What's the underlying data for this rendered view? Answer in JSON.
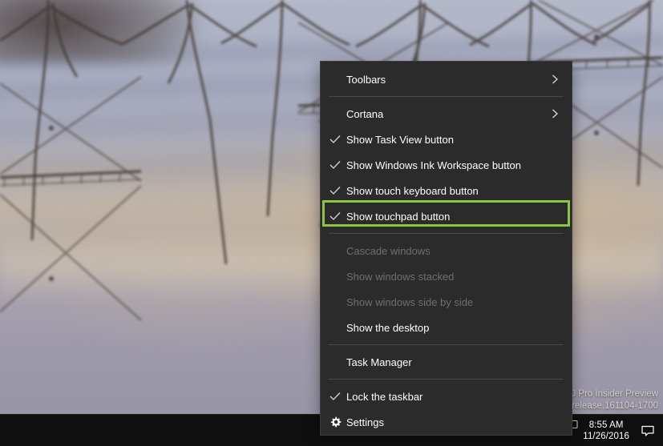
{
  "desktop": {
    "wallpaper_description": "blurred photo of a pier structure over calm water",
    "wallpaper_colors": {
      "top": "#b9bdcb",
      "mid_warm": "#c8b291",
      "bottom": "#9a97a8"
    }
  },
  "context_menu": {
    "name": "taskbar-context-menu",
    "background": "#2b2b2b",
    "items": [
      {
        "id": "toolbars",
        "label": "Toolbars",
        "type": "submenu",
        "checked": false,
        "disabled": false,
        "separator_after": true
      },
      {
        "id": "cortana",
        "label": "Cortana",
        "type": "submenu",
        "checked": false,
        "disabled": false,
        "separator_after": false
      },
      {
        "id": "task-view",
        "label": "Show Task View button",
        "type": "checkbox",
        "checked": true,
        "disabled": false,
        "separator_after": false
      },
      {
        "id": "windows-ink",
        "label": "Show Windows Ink Workspace button",
        "type": "checkbox",
        "checked": true,
        "disabled": false,
        "separator_after": false
      },
      {
        "id": "touch-keyboard",
        "label": "Show touch keyboard button",
        "type": "checkbox",
        "checked": true,
        "disabled": false,
        "separator_after": false
      },
      {
        "id": "touchpad",
        "label": "Show touchpad button",
        "type": "checkbox",
        "checked": true,
        "disabled": false,
        "separator_after": true,
        "highlighted": true
      },
      {
        "id": "cascade",
        "label": "Cascade windows",
        "type": "command",
        "checked": false,
        "disabled": true,
        "separator_after": false
      },
      {
        "id": "stacked",
        "label": "Show windows stacked",
        "type": "command",
        "checked": false,
        "disabled": true,
        "separator_after": false
      },
      {
        "id": "side-by-side",
        "label": "Show windows side by side",
        "type": "command",
        "checked": false,
        "disabled": true,
        "separator_after": false
      },
      {
        "id": "show-desktop",
        "label": "Show the desktop",
        "type": "command",
        "checked": false,
        "disabled": false,
        "separator_after": true
      },
      {
        "id": "task-manager",
        "label": "Task Manager",
        "type": "command",
        "checked": false,
        "disabled": false,
        "separator_after": true
      },
      {
        "id": "lock-taskbar",
        "label": "Lock the taskbar",
        "type": "checkbox",
        "checked": true,
        "disabled": false,
        "separator_after": false
      },
      {
        "id": "settings",
        "label": "Settings",
        "type": "command",
        "checked": false,
        "disabled": false,
        "icon": "gear-icon",
        "separator_after": false
      }
    ]
  },
  "annotation": {
    "target_item": "Show touchpad button",
    "color": "#8cc63f",
    "style": "rectangle-outline"
  },
  "taskbar": {
    "background": "#0f0f0f",
    "tray_icons": [
      {
        "id": "hidden-icons",
        "name": "chevron-up-icon"
      },
      {
        "id": "volume",
        "name": "speaker-icon"
      },
      {
        "id": "network",
        "name": "wifi-icon"
      },
      {
        "id": "battery",
        "name": "battery-icon"
      },
      {
        "id": "touch-keyboard",
        "name": "keyboard-icon"
      },
      {
        "id": "touchpad",
        "name": "touchpad-icon"
      }
    ],
    "clock": {
      "time": "8:55 AM",
      "date": "11/26/2016"
    },
    "action_center": {
      "name": "action-center-icon",
      "label": "Action Center"
    }
  },
  "watermark": {
    "line1": "0 Pro Insider Preview",
    "line2": "erelease.161104-1700",
    "note": "partially occluded by context menu"
  }
}
